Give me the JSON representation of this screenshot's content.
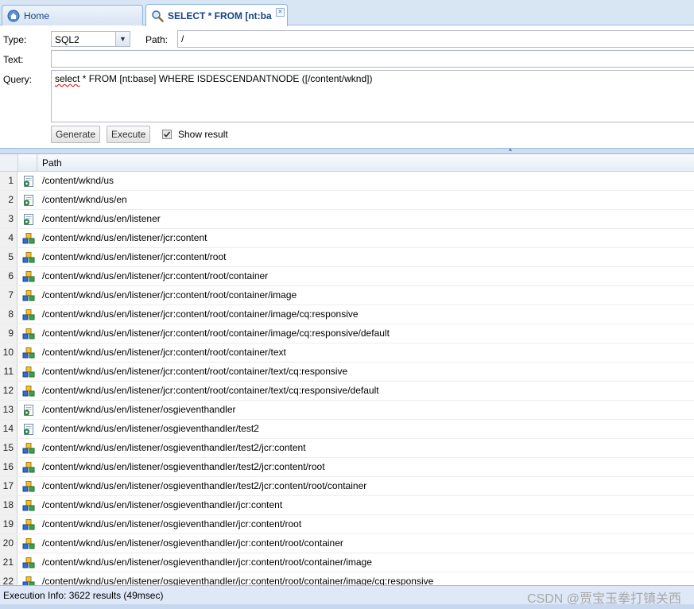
{
  "tabs": [
    {
      "label": "Home",
      "icon": "home-icon",
      "active": false
    },
    {
      "label": "SELECT * FROM [nt:ba",
      "icon": "search-icon",
      "active": true
    }
  ],
  "form": {
    "type_label": "Type:",
    "type_value": "SQL2",
    "path_label": "Path:",
    "path_value": "/",
    "text_label": "Text:",
    "text_value": "",
    "query_label": "Query:",
    "query_word": "select",
    "query_rest": " * FROM [nt:base] WHERE ISDESCENDANTNODE ([/content/wknd])",
    "generate_label": "Generate",
    "execute_label": "Execute",
    "show_result_label": "Show result",
    "show_result_checked": true
  },
  "grid": {
    "column_path": "Path",
    "rows": [
      {
        "n": "1",
        "icon": "page-icon",
        "path": "/content/wknd/us"
      },
      {
        "n": "2",
        "icon": "page-icon",
        "path": "/content/wknd/us/en"
      },
      {
        "n": "3",
        "icon": "page-icon",
        "path": "/content/wknd/us/en/listener"
      },
      {
        "n": "4",
        "icon": "node-icon",
        "path": "/content/wknd/us/en/listener/jcr:content"
      },
      {
        "n": "5",
        "icon": "node-icon",
        "path": "/content/wknd/us/en/listener/jcr:content/root"
      },
      {
        "n": "6",
        "icon": "node-icon",
        "path": "/content/wknd/us/en/listener/jcr:content/root/container"
      },
      {
        "n": "7",
        "icon": "node-icon",
        "path": "/content/wknd/us/en/listener/jcr:content/root/container/image"
      },
      {
        "n": "8",
        "icon": "node-icon",
        "path": "/content/wknd/us/en/listener/jcr:content/root/container/image/cq:responsive"
      },
      {
        "n": "9",
        "icon": "node-icon",
        "path": "/content/wknd/us/en/listener/jcr:content/root/container/image/cq:responsive/default"
      },
      {
        "n": "10",
        "icon": "node-icon",
        "path": "/content/wknd/us/en/listener/jcr:content/root/container/text"
      },
      {
        "n": "11",
        "icon": "node-icon",
        "path": "/content/wknd/us/en/listener/jcr:content/root/container/text/cq:responsive"
      },
      {
        "n": "12",
        "icon": "node-icon",
        "path": "/content/wknd/us/en/listener/jcr:content/root/container/text/cq:responsive/default"
      },
      {
        "n": "13",
        "icon": "page-icon",
        "path": "/content/wknd/us/en/listener/osgieventhandler"
      },
      {
        "n": "14",
        "icon": "page-icon",
        "path": "/content/wknd/us/en/listener/osgieventhandler/test2"
      },
      {
        "n": "15",
        "icon": "node-icon",
        "path": "/content/wknd/us/en/listener/osgieventhandler/test2/jcr:content"
      },
      {
        "n": "16",
        "icon": "node-icon",
        "path": "/content/wknd/us/en/listener/osgieventhandler/test2/jcr:content/root"
      },
      {
        "n": "17",
        "icon": "node-icon",
        "path": "/content/wknd/us/en/listener/osgieventhandler/test2/jcr:content/root/container"
      },
      {
        "n": "18",
        "icon": "node-icon",
        "path": "/content/wknd/us/en/listener/osgieventhandler/jcr:content"
      },
      {
        "n": "19",
        "icon": "node-icon",
        "path": "/content/wknd/us/en/listener/osgieventhandler/jcr:content/root"
      },
      {
        "n": "20",
        "icon": "node-icon",
        "path": "/content/wknd/us/en/listener/osgieventhandler/jcr:content/root/container"
      },
      {
        "n": "21",
        "icon": "node-icon",
        "path": "/content/wknd/us/en/listener/osgieventhandler/jcr:content/root/container/image"
      },
      {
        "n": "22",
        "icon": "node-icon",
        "path": "/content/wknd/us/en/listener/osgieventhandler/jcr:content/root/container/image/cq:responsive"
      }
    ]
  },
  "status": {
    "execution_info": "Execution Info: 3622 results (49msec)",
    "watermark": "CSDN @贾宝玉拳打镇关西"
  },
  "colors": {
    "tab_text": "#15428b",
    "panel_border": "#99bbe8",
    "status_bg": "#dfe8f6"
  }
}
